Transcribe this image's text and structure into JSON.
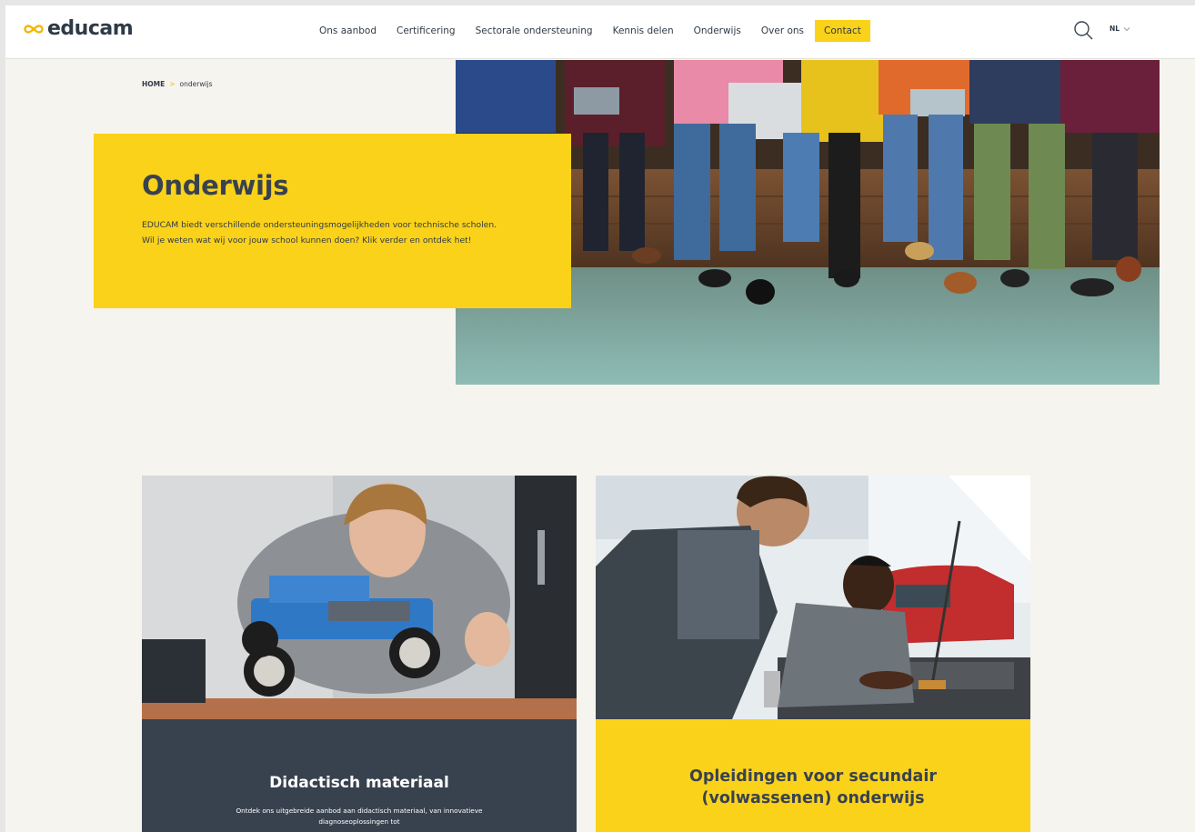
{
  "header": {
    "logo_text": "educam",
    "nav": [
      {
        "label": "Ons aanbod"
      },
      {
        "label": "Certificering"
      },
      {
        "label": "Sectorale ondersteuning"
      },
      {
        "label": "Kennis delen"
      },
      {
        "label": "Onderwijs"
      },
      {
        "label": "Over ons"
      }
    ],
    "contact_label": "Contact",
    "lang": "NL",
    "icons": {
      "search": "search-icon",
      "lang_chevron": "chevron-down-icon",
      "logo": "infinity-logo-icon"
    }
  },
  "breadcrumb": {
    "home": "HOME",
    "separator": ">",
    "current": "onderwijs"
  },
  "hero": {
    "title": "Onderwijs",
    "text": "EDUCAM biedt verschillende ondersteuningsmogelijkheden voor technische scholen. Wil je weten wat wij voor jouw school kunnen doen? Klik verder en ontdek het!",
    "image": "students-on-bench-photo"
  },
  "cards": [
    {
      "title": "Didactisch materiaal",
      "text": "Ontdek ons uitgebreide aanbod aan didactisch materiaal, van innovatieve diagnoseoplossingen tot",
      "image": "boy-with-model-car-photo"
    },
    {
      "title": "Opleidingen voor secundair (volwassenen) onderwijs",
      "image": "mechanics-under-hood-photo"
    }
  ],
  "colors": {
    "accent_yellow": "#fbd21a",
    "dark_slate": "#38424f",
    "page_background": "#f6f4ef"
  }
}
